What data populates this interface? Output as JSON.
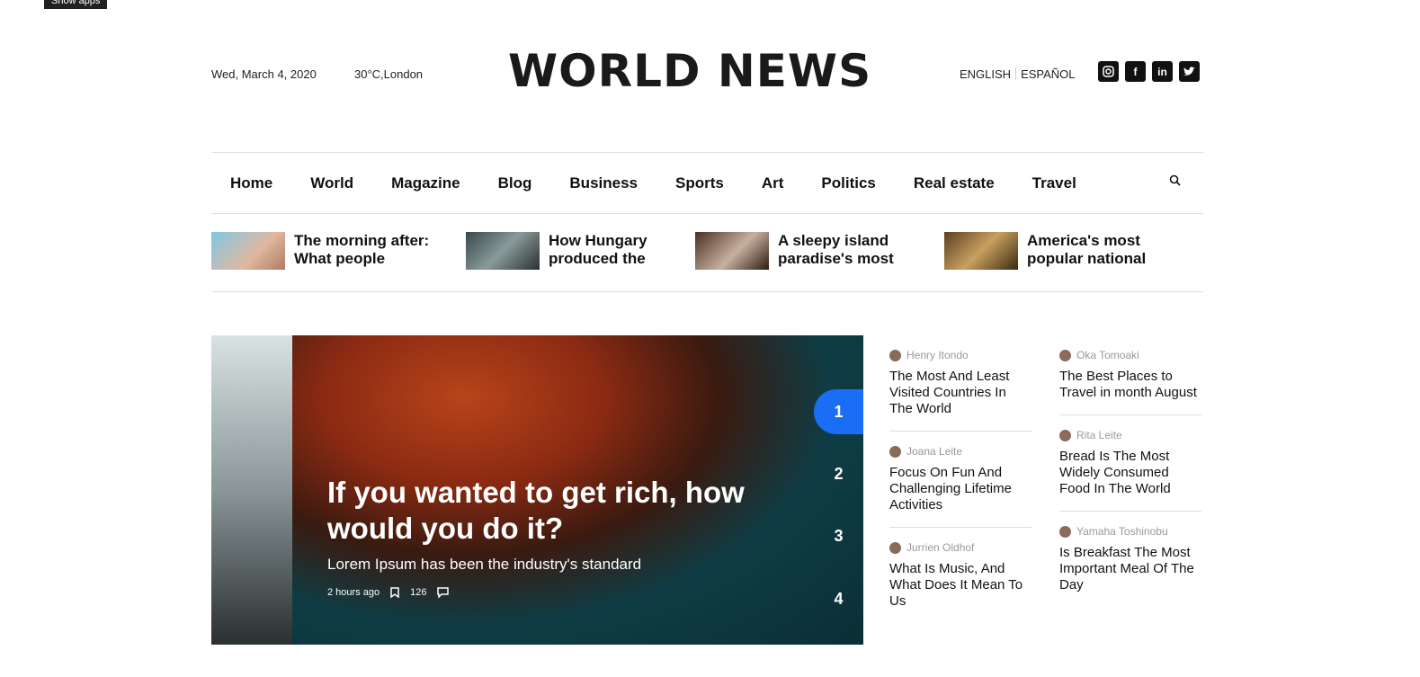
{
  "tooltip": "Show apps",
  "header": {
    "date": "Wed, March 4, 2020",
    "weather": "30°C,London",
    "logo": "WORLD NEWS",
    "lang_en": "ENGLISH",
    "lang_es": "ESPAÑOL",
    "socials": [
      "instagram",
      "facebook",
      "linkedin",
      "twitter"
    ]
  },
  "nav": {
    "items": [
      "Home",
      "World",
      "Magazine",
      "Blog",
      "Business",
      "Sports",
      "Art",
      "Politics",
      "Real estate",
      "Travel"
    ]
  },
  "trending": [
    {
      "title_line1": "The morning after:",
      "title_line2": "What people"
    },
    {
      "title_line1": "How Hungary",
      "title_line2": "produced the"
    },
    {
      "title_line1": "A sleepy island",
      "title_line2": "paradise's most"
    },
    {
      "title_line1": "America's most",
      "title_line2": "popular national"
    }
  ],
  "hero": {
    "title": "If you wanted to get rich, how would you do it?",
    "subtitle": "Lorem Ipsum has been the industry's standard",
    "time": "2 hours ago",
    "comments": "126",
    "slides": [
      "1",
      "2",
      "3",
      "4"
    ]
  },
  "news": {
    "col1": [
      {
        "author": "Henry Itondo",
        "title": "The Most And Least Visited Countries In The World"
      },
      {
        "author": "Joana Leite",
        "title": "Focus On Fun And Challenging Lifetime Activities"
      },
      {
        "author": "Jurrien Oldhof",
        "title": "What Is Music, And What Does It Mean To Us"
      }
    ],
    "col2": [
      {
        "author": "Oka Tomoaki",
        "title": "The Best Places to Travel in month August"
      },
      {
        "author": "Rita Leite",
        "title": "Bread Is The Most Widely Consumed Food In The World"
      },
      {
        "author": "Yamaha Toshinobu",
        "title": "Is Breakfast The Most Important Meal Of The Day"
      }
    ]
  }
}
